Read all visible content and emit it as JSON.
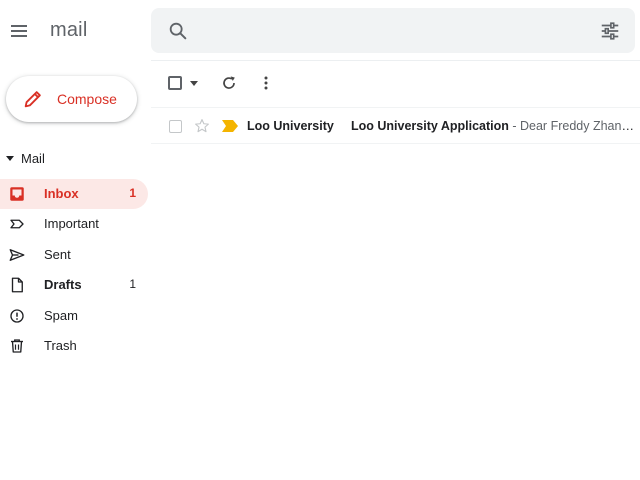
{
  "app": {
    "logo_text": "mail"
  },
  "search": {
    "placeholder": "",
    "value": ""
  },
  "compose": {
    "label": "Compose"
  },
  "sidebar": {
    "section_label": "Mail",
    "items": [
      {
        "label": "Inbox",
        "count": "1",
        "icon": "inbox-icon",
        "active": true
      },
      {
        "label": "Important",
        "count": "",
        "icon": "important-icon",
        "active": false
      },
      {
        "label": "Sent",
        "count": "",
        "icon": "send-icon",
        "active": false
      },
      {
        "label": "Drafts",
        "count": "1",
        "icon": "draft-icon",
        "active": false
      },
      {
        "label": "Spam",
        "count": "",
        "icon": "spam-icon",
        "active": false
      },
      {
        "label": "Trash",
        "count": "",
        "icon": "trash-icon",
        "active": false
      }
    ]
  },
  "emails": [
    {
      "sender": "Loo University",
      "subject": "Loo University Application",
      "separator": " - ",
      "snippet": "Dear Freddy Zhang, ..."
    }
  ],
  "colors": {
    "accent_red": "#d93025",
    "active_bg": "#fce8e6",
    "important_yellow": "#f4b400",
    "search_bg": "#f1f3f4",
    "icon_gray": "#5f6368"
  }
}
